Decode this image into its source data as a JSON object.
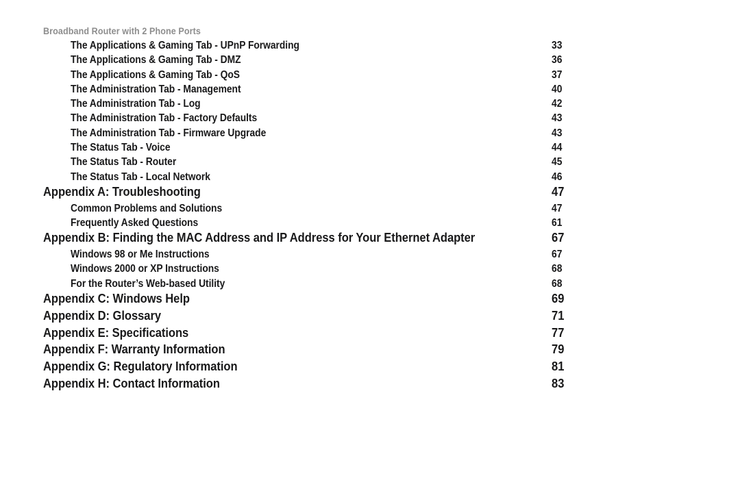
{
  "header": {
    "running_title": "Broadband Router with 2 Phone Ports"
  },
  "colors": {
    "page_background": "#ffffff",
    "body_text": "#19191a",
    "running_header_text": "#8d8d8d"
  },
  "toc": {
    "entries": [
      {
        "level": 2,
        "label": "The Applications & Gaming Tab - UPnP Forwarding",
        "page": "33"
      },
      {
        "level": 2,
        "label": "The Applications & Gaming Tab - DMZ",
        "page": "36"
      },
      {
        "level": 2,
        "label": "The Applications & Gaming Tab - QoS",
        "page": "37"
      },
      {
        "level": 2,
        "label": "The Administration Tab - Management",
        "page": "40"
      },
      {
        "level": 2,
        "label": "The Administration Tab - Log",
        "page": "42"
      },
      {
        "level": 2,
        "label": "The Administration Tab - Factory Defaults",
        "page": "43"
      },
      {
        "level": 2,
        "label": "The Administration Tab - Firmware Upgrade",
        "page": "43"
      },
      {
        "level": 2,
        "label": "The Status Tab - Voice",
        "page": "44"
      },
      {
        "level": 2,
        "label": "The Status Tab - Router",
        "page": "45"
      },
      {
        "level": 2,
        "label": "The Status Tab - Local Network",
        "page": "46"
      },
      {
        "level": 1,
        "label": "Appendix A: Troubleshooting",
        "page": "47"
      },
      {
        "level": 2,
        "label": "Common Problems and Solutions",
        "page": "47"
      },
      {
        "level": 2,
        "label": "Frequently Asked Questions",
        "page": "61"
      },
      {
        "level": 1,
        "label": "Appendix B: Finding the MAC Address and IP Address for Your Ethernet Adapter",
        "page": "67"
      },
      {
        "level": 2,
        "label": "Windows 98 or Me Instructions",
        "page": "67"
      },
      {
        "level": 2,
        "label": "Windows 2000 or XP Instructions",
        "page": "68"
      },
      {
        "level": 2,
        "label": "For the Router’s Web-based Utility",
        "page": "68"
      },
      {
        "level": 1,
        "label": "Appendix C: Windows Help",
        "page": "69"
      },
      {
        "level": 1,
        "label": "Appendix D: Glossary",
        "page": "71"
      },
      {
        "level": 1,
        "label": "Appendix E: Specifications",
        "page": "77"
      },
      {
        "level": 1,
        "label": "Appendix F: Warranty Information",
        "page": "79"
      },
      {
        "level": 1,
        "label": "Appendix G: Regulatory Information",
        "page": "81"
      },
      {
        "level": 1,
        "label": "Appendix H: Contact Information",
        "page": "83"
      }
    ]
  }
}
